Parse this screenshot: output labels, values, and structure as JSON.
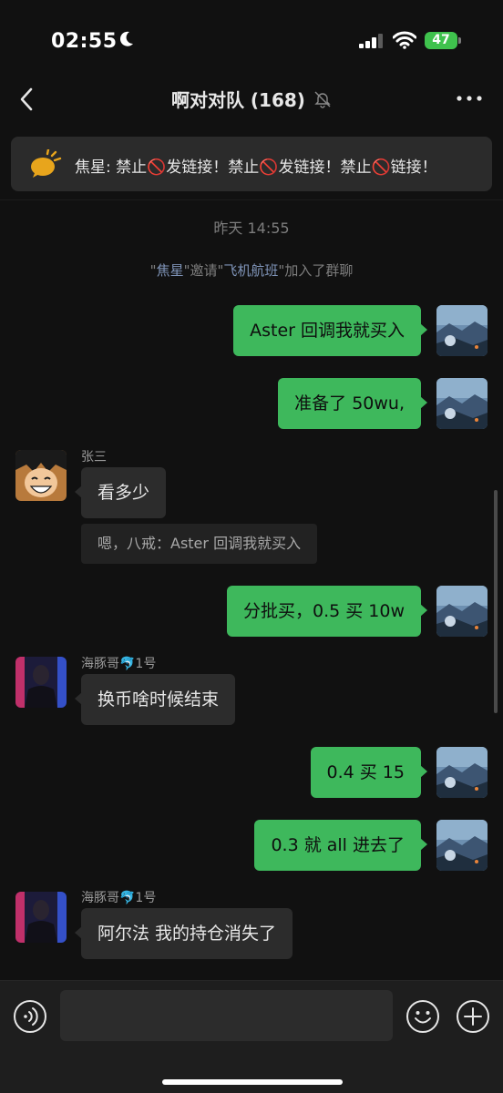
{
  "status_bar": {
    "time": "02:55",
    "battery": "47"
  },
  "nav": {
    "title": "啊对对队 (168)"
  },
  "pinned": {
    "sender": "焦星",
    "text": "焦星: 禁止🚫发链接！禁止🚫发链接！禁止🚫链接！"
  },
  "chat": {
    "timestamp": "昨天 14:55",
    "system": {
      "quote_open": "\"",
      "inviter": "焦星",
      "mid": "\"邀请\"",
      "invitee": "飞机航班",
      "tail": "\"加入了群聊"
    },
    "messages": [
      {
        "side": "out",
        "text": "Aster 回调我就买入"
      },
      {
        "side": "out",
        "text": "准备了 50wu,"
      },
      {
        "side": "in",
        "sender": "张三",
        "text": "看多少",
        "quote": "嗯，八戒：Aster 回调我就买入"
      },
      {
        "side": "out",
        "text": "分批买，0.5 买 10w"
      },
      {
        "side": "in",
        "sender": "海豚哥🐬1号",
        "text": "换币啥时候结束"
      },
      {
        "side": "out",
        "text": "0.4 买 15"
      },
      {
        "side": "out",
        "text": "0.3 就 all 进去了"
      },
      {
        "side": "in",
        "sender": "海豚哥🐬1号",
        "text": "阿尔法 我的持仓消失了"
      }
    ]
  },
  "input": {
    "placeholder": "",
    "value": ""
  },
  "colors": {
    "outgoing_bubble": "#3eb85c",
    "incoming_bubble": "#2c2c2c",
    "background": "#111111",
    "link_name": "#7f94b8"
  },
  "icons": [
    "back-icon",
    "mute-icon",
    "more-icon",
    "announcement-icon",
    "voice-icon",
    "emoji-icon",
    "plus-icon"
  ]
}
